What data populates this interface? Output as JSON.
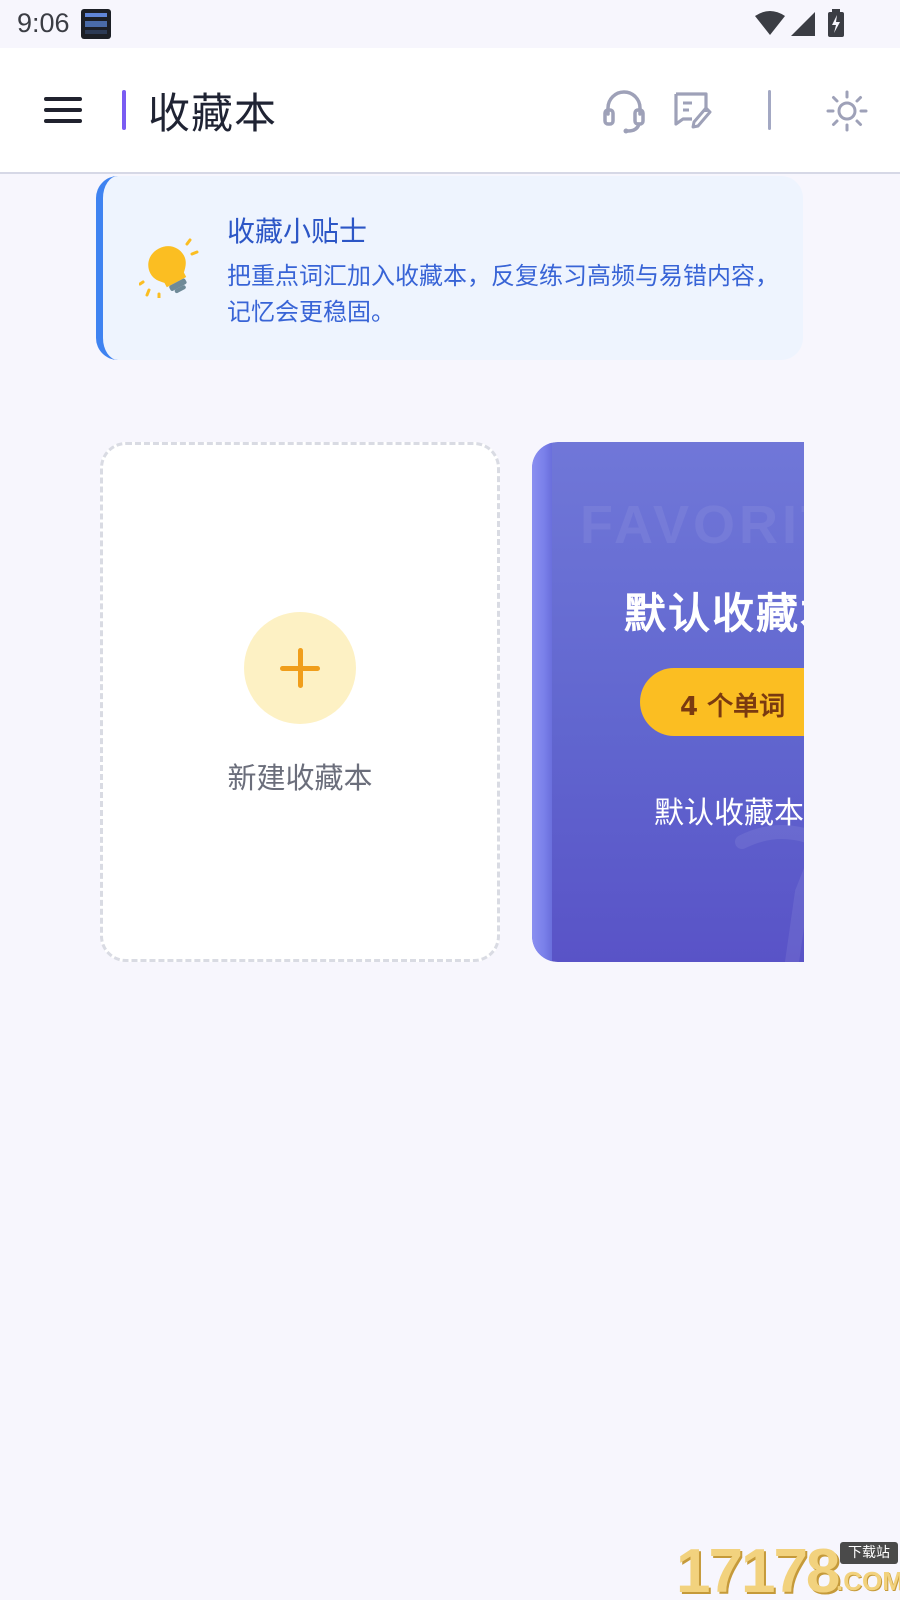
{
  "status_bar": {
    "time": "9:06"
  },
  "header": {
    "title": "收藏本"
  },
  "tip": {
    "title": "收藏小贴士",
    "text": "把重点词汇加入收藏本，反复练习高频与易错内容，记忆会更稳固。"
  },
  "cards": {
    "new_card": {
      "label": "新建收藏本"
    },
    "default_book": {
      "watermark": "FAVORITE",
      "name": "默认收藏本",
      "badge": "4 个单词",
      "subtitle": "默认收藏本"
    }
  },
  "watermark_brand": {
    "digits": "17178",
    "tag": "下载站",
    "com": ".COM"
  },
  "colors": {
    "accent": "#7a5cf2",
    "tip_border": "#3f83f1",
    "tip_bg": "#eef4fe",
    "book_bg": "#6166cf",
    "badge_bg": "#fbbe22",
    "add_icon": "#f09e1b"
  },
  "icons": {
    "menu": "menu-icon",
    "support": "headset-icon",
    "note": "note-edit-icon",
    "theme": "sun-icon",
    "tip": "lightbulb-icon",
    "add": "plus-icon"
  }
}
